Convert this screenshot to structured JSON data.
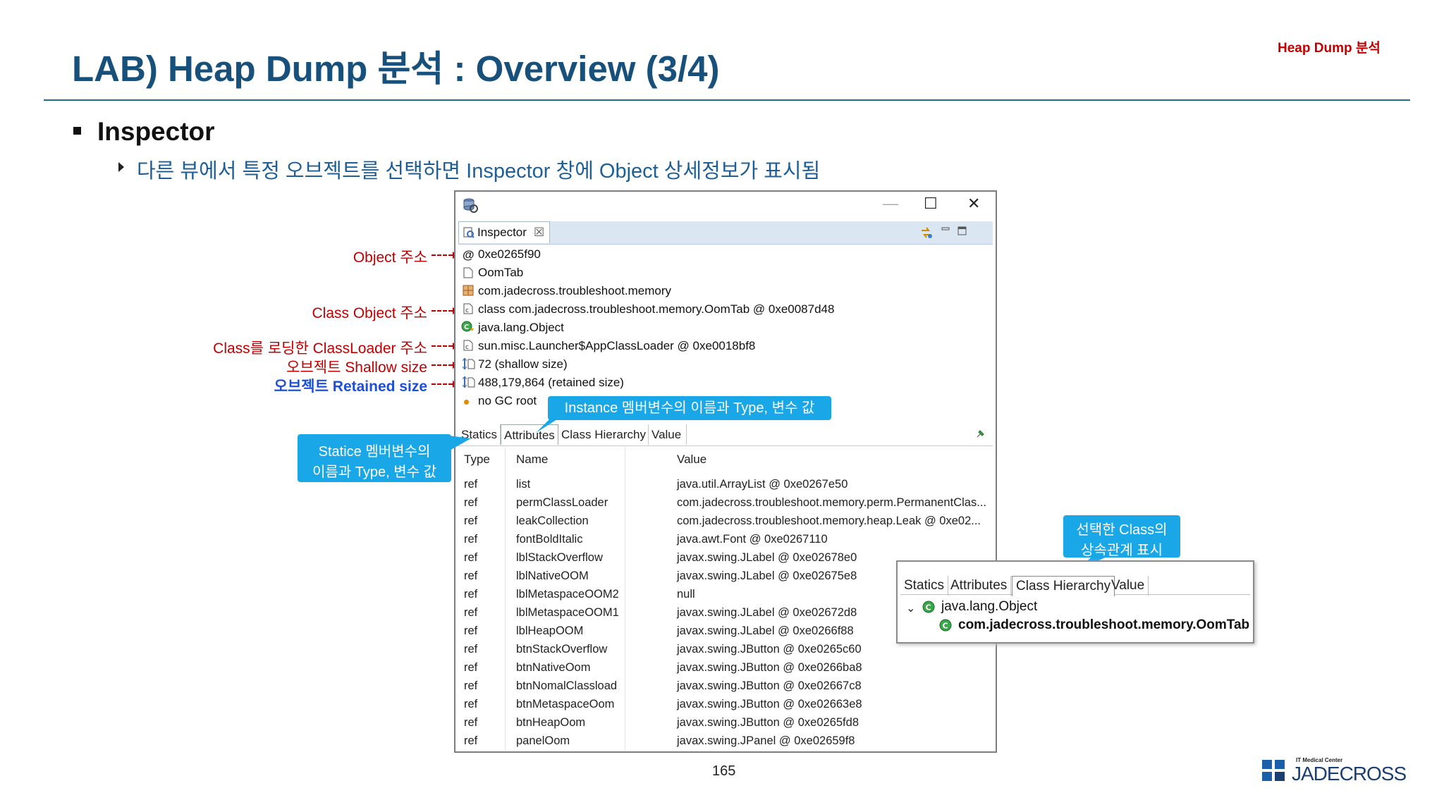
{
  "header": {
    "title": "LAB) Heap Dump 분석 : Overview (3/4)",
    "tag": "Heap Dump 분석"
  },
  "section": {
    "title": "Inspector",
    "description": "다른 뷰에서 특정 오브젝트를 선택하면 Inspector 창에 Object 상세정보가 표시됨"
  },
  "annotations": {
    "object_address": "Object 주소",
    "class_object_address": "Class Object 주소",
    "classloader_address": "Class를 로딩한 ClassLoader 주소",
    "shallow_size": "오브젝트 Shallow size",
    "retained_size": "오브젝트 Retained size"
  },
  "window": {
    "minimize": "—",
    "maximize": "☐",
    "close": "✕",
    "tab_label": "Inspector",
    "tab_close": "☒"
  },
  "inspector_rows": [
    {
      "icon": "at-icon",
      "text": "0xe0265f90"
    },
    {
      "icon": "document-icon",
      "text": "OomTab"
    },
    {
      "icon": "package-icon",
      "text": "com.jadecross.troubleshoot.memory"
    },
    {
      "icon": "class-file-icon",
      "text": "class com.jadecross.troubleshoot.memory.OomTab @ 0xe0087d48"
    },
    {
      "icon": "superclass-icon",
      "text": "java.lang.Object"
    },
    {
      "icon": "class-file-icon",
      "text": "sun.misc.Launcher$AppClassLoader @ 0xe0018bf8"
    },
    {
      "icon": "size-icon",
      "text": "72 (shallow size)"
    },
    {
      "icon": "size-icon",
      "text": "488,179,864 (retained size)"
    },
    {
      "icon": "gc-root-icon",
      "text": "no GC root"
    }
  ],
  "table": {
    "tabs": [
      "Statics",
      "Attributes",
      "Class Hierarchy",
      "Value"
    ],
    "active_tab": "Attributes",
    "headers": [
      "Type",
      "Name",
      "Value"
    ],
    "rows": [
      [
        "ref",
        "list",
        "java.util.ArrayList @ 0xe0267e50"
      ],
      [
        "ref",
        "permClassLoader",
        "com.jadecross.troubleshoot.memory.perm.PermanentClas..."
      ],
      [
        "ref",
        "leakCollection",
        "com.jadecross.troubleshoot.memory.heap.Leak @ 0xe02..."
      ],
      [
        "ref",
        "fontBoldItalic",
        "java.awt.Font @ 0xe0267110"
      ],
      [
        "ref",
        "lblStackOverflow",
        "javax.swing.JLabel @ 0xe02678e0"
      ],
      [
        "ref",
        "lblNativeOOM",
        "javax.swing.JLabel @ 0xe02675e8"
      ],
      [
        "ref",
        "lblMetaspaceOOM2",
        "null"
      ],
      [
        "ref",
        "lblMetaspaceOOM1",
        "javax.swing.JLabel @ 0xe02672d8"
      ],
      [
        "ref",
        "lblHeapOOM",
        "javax.swing.JLabel @ 0xe0266f88"
      ],
      [
        "ref",
        "btnStackOverflow",
        "javax.swing.JButton @ 0xe0265c60"
      ],
      [
        "ref",
        "btnNativeOom",
        "javax.swing.JButton @ 0xe0266ba8"
      ],
      [
        "ref",
        "btnNomalClassload",
        "javax.swing.JButton @ 0xe02667c8"
      ],
      [
        "ref",
        "btnMetaspaceOom",
        "javax.swing.JButton @ 0xe02663e8"
      ],
      [
        "ref",
        "btnHeapOom",
        "javax.swing.JButton @ 0xe0265fd8"
      ],
      [
        "ref",
        "panelOom",
        "javax.swing.JPanel @ 0xe02659f8"
      ]
    ]
  },
  "callouts": {
    "instance": "Instance 멤버변수의 이름과 Type, 변수 값",
    "static_line1": "Statice 멤버변수의",
    "static_line2": "이름과 Type, 변수 값",
    "class_line1": "선택한 Class의",
    "class_line2": "상속관계 표시"
  },
  "class_hierarchy": {
    "tabs": [
      "Statics",
      "Attributes",
      "Class Hierarchy",
      "Value"
    ],
    "active_tab": "Class Hierarchy",
    "root": "java.lang.Object",
    "child": "com.jadecross.troubleshoot.memory.OomTab"
  },
  "footer": {
    "page_number": "165",
    "logo_small": "IT Medical Center",
    "logo_text": "JADECROSS"
  },
  "colors": {
    "title": "#17507a",
    "accent_red": "#c00000",
    "callout": "#1aa7e8",
    "retained_blue": "#1e4fd8"
  }
}
